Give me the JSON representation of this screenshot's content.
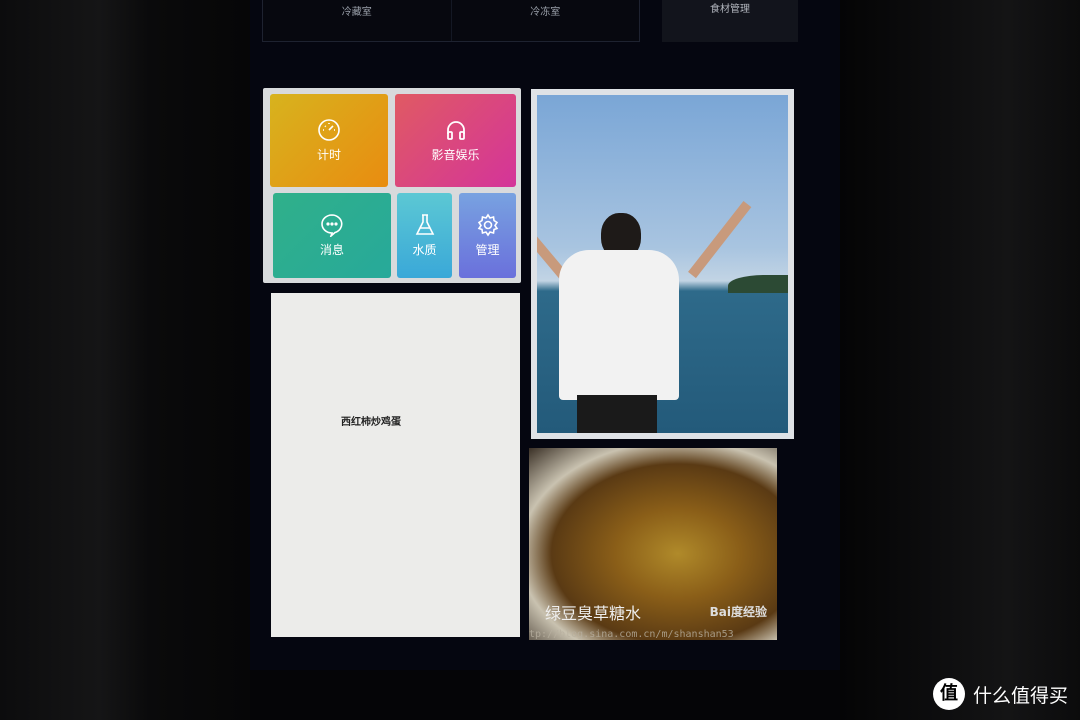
{
  "top_tabs": [
    {
      "label": "冷藏室"
    },
    {
      "label": "冷冻室"
    }
  ],
  "food_management": "食材管理",
  "tiles": [
    {
      "label": "计时",
      "icon": "gauge-icon",
      "color": "#e0a018"
    },
    {
      "label": "影音娱乐",
      "icon": "headphones-icon",
      "color": "#d8407c"
    },
    {
      "label": "消息",
      "icon": "chat-bubble-icon",
      "color": "#2dad90"
    },
    {
      "label": "水质",
      "icon": "flask-icon",
      "color": "#48b8d6"
    },
    {
      "label": "管理",
      "icon": "gear-icon",
      "color": "#7088de"
    }
  ],
  "recipe_card": {
    "title": "西红柿炒鸡蛋"
  },
  "food_card": {
    "title": "绿豆臭草糖水",
    "logo": "Bai度经验",
    "url": "tp://blog.sina.com.cn/m/shanshan53"
  },
  "watermark": {
    "text": "什么值得买",
    "logo": "值"
  }
}
